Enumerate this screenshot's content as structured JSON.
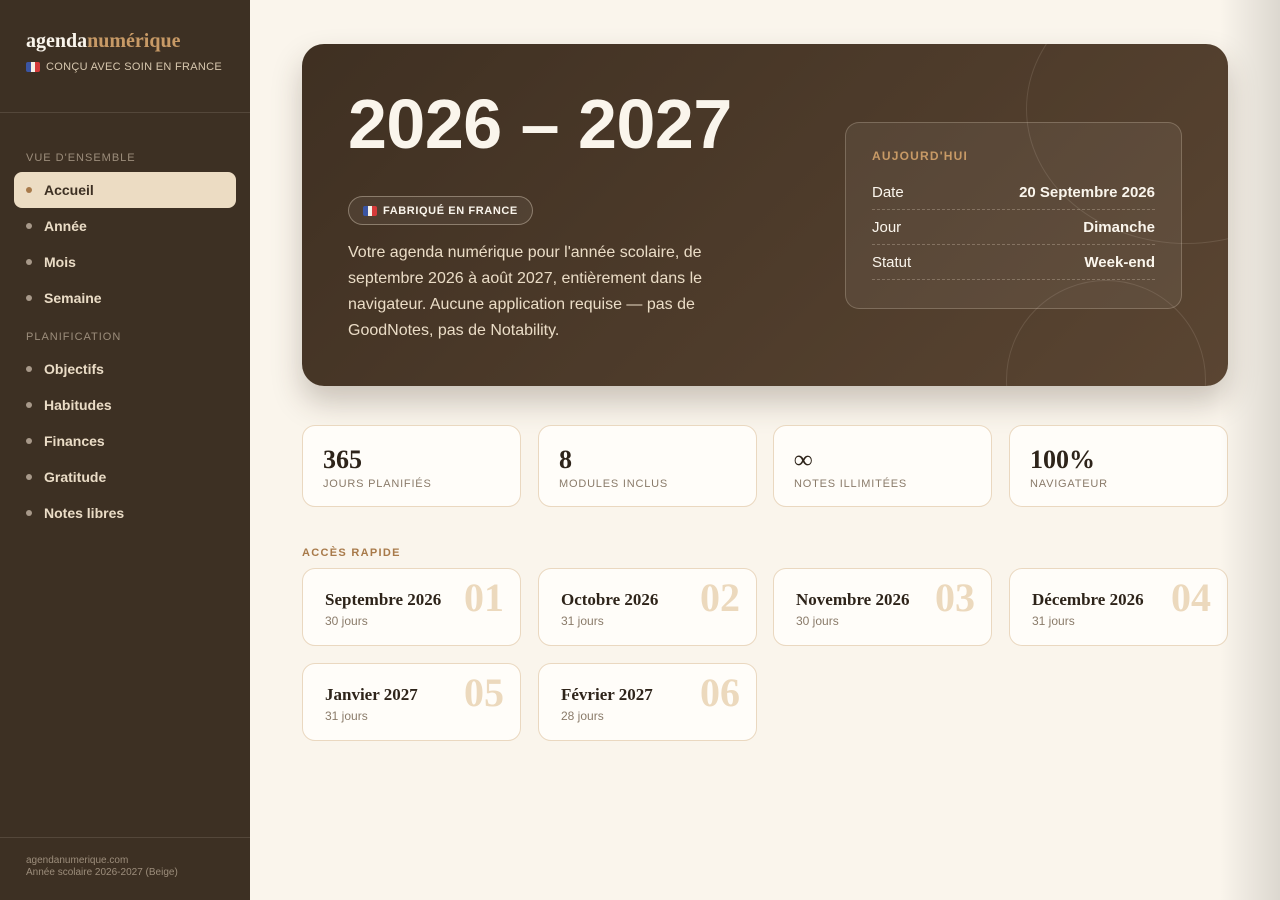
{
  "brand": {
    "name_a": "agenda",
    "name_b": "numérique",
    "tagline": "Conçu avec soin en France"
  },
  "sidebar": {
    "sections": [
      {
        "label": "Vue d'ensemble",
        "items": [
          {
            "label": "Accueil",
            "active": true
          },
          {
            "label": "Année",
            "active": false
          },
          {
            "label": "Mois",
            "active": false
          },
          {
            "label": "Semaine",
            "active": false
          }
        ]
      },
      {
        "label": "Planification",
        "items": [
          {
            "label": "Objectifs",
            "active": false
          },
          {
            "label": "Habitudes",
            "active": false
          },
          {
            "label": "Finances",
            "active": false
          },
          {
            "label": "Gratitude",
            "active": false
          },
          {
            "label": "Notes libres",
            "active": false
          }
        ]
      }
    ],
    "footer": {
      "site": "agendanumerique.com",
      "edition": "Année scolaire 2026-2027 (Beige)"
    }
  },
  "hero": {
    "title": "2026 – 2027",
    "badge": "Fabriqué en France",
    "description": "Votre agenda numérique pour l'année scolaire, de septembre 2026 à août 2027, entièrement dans le navigateur. Aucune application requise — pas de GoodNotes, pas de Notability.",
    "today": {
      "title": "Aujourd'hui",
      "rows": [
        {
          "label": "Date",
          "value": "20 Septembre 2026"
        },
        {
          "label": "Jour",
          "value": "Dimanche"
        },
        {
          "label": "Statut",
          "value": "Week-end"
        }
      ]
    }
  },
  "stats": [
    {
      "value": "365",
      "label": "Jours planifiés"
    },
    {
      "value": "8",
      "label": "Modules inclus"
    },
    {
      "value": "∞",
      "label": "Notes illimitées"
    },
    {
      "value": "100%",
      "label": "Navigateur"
    }
  ],
  "quick_access": {
    "label": "Accès rapide",
    "months": [
      {
        "name": "Septembre 2026",
        "days": "30 jours",
        "num": "01"
      },
      {
        "name": "Octobre 2026",
        "days": "31 jours",
        "num": "02"
      },
      {
        "name": "Novembre 2026",
        "days": "30 jours",
        "num": "03"
      },
      {
        "name": "Décembre 2026",
        "days": "31 jours",
        "num": "04"
      },
      {
        "name": "Janvier 2027",
        "days": "31 jours",
        "num": "05"
      },
      {
        "name": "Février 2027",
        "days": "28 jours",
        "num": "06"
      }
    ]
  },
  "icons": {
    "flag": "french-flag-icon",
    "nav_bullet": "dot-icon"
  },
  "colors": {
    "sidebar_bg": "#3d3023",
    "accent": "#c89a66",
    "page_bg": "#faf5ec",
    "active_item_bg": "#ecdcc3"
  }
}
